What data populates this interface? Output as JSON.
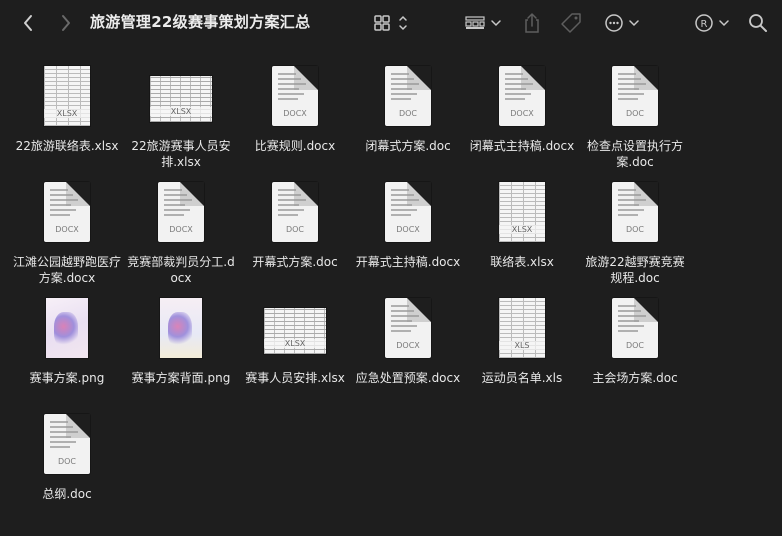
{
  "window": {
    "title": "旅游管理22级赛事策划方案汇总"
  },
  "toolbar": {
    "back_icon": "chevron-left-icon",
    "forward_icon": "chevron-right-icon",
    "view_icon": "grid-view-icon",
    "group_icon": "group-icon",
    "share_icon": "share-icon",
    "tag_icon": "tag-icon",
    "more_icon": "ellipsis-circle-icon",
    "account_icon": "registered-icon",
    "search_icon": "search-icon"
  },
  "files": [
    {
      "name": "22旅游联络表.xlsx",
      "kind": "sheet",
      "tag": "XLSX"
    },
    {
      "name": "22旅游赛事人员安排.xlsx",
      "kind": "wide",
      "tag": "XLSX"
    },
    {
      "name": "比赛规则.docx",
      "kind": "doc",
      "tag": "DOCX"
    },
    {
      "name": "闭幕式方案.doc",
      "kind": "doc",
      "tag": "DOC"
    },
    {
      "name": "闭幕式主持稿.docx",
      "kind": "doc",
      "tag": "DOCX"
    },
    {
      "name": "检查点设置执行方案.doc",
      "kind": "doc",
      "tag": "DOC"
    },
    {
      "name": "江滩公园越野跑医疗方案.docx",
      "kind": "doc",
      "tag": "DOCX"
    },
    {
      "name": "竞赛部裁判员分工.docx",
      "kind": "doc",
      "tag": "DOCX"
    },
    {
      "name": "开幕式方案.doc",
      "kind": "doc",
      "tag": "DOC"
    },
    {
      "name": "开幕式主持稿.docx",
      "kind": "doc",
      "tag": "DOCX"
    },
    {
      "name": "联络表.xlsx",
      "kind": "sheet",
      "tag": "XLSX"
    },
    {
      "name": "旅游22越野赛竞赛规程.doc",
      "kind": "doc",
      "tag": "DOC"
    },
    {
      "name": "赛事方案.png",
      "kind": "png",
      "tag": ""
    },
    {
      "name": "赛事方案背面.png",
      "kind": "png",
      "tag": ""
    },
    {
      "name": "赛事人员安排.xlsx",
      "kind": "wide",
      "tag": "XLSX"
    },
    {
      "name": "应急处置预案.docx",
      "kind": "doc",
      "tag": "DOCX"
    },
    {
      "name": "运动员名单.xls",
      "kind": "sheet",
      "tag": "XLS"
    },
    {
      "name": "主会场方案.doc",
      "kind": "doc",
      "tag": "DOC"
    },
    {
      "name": "总纲.doc",
      "kind": "doc",
      "tag": "DOC"
    }
  ]
}
